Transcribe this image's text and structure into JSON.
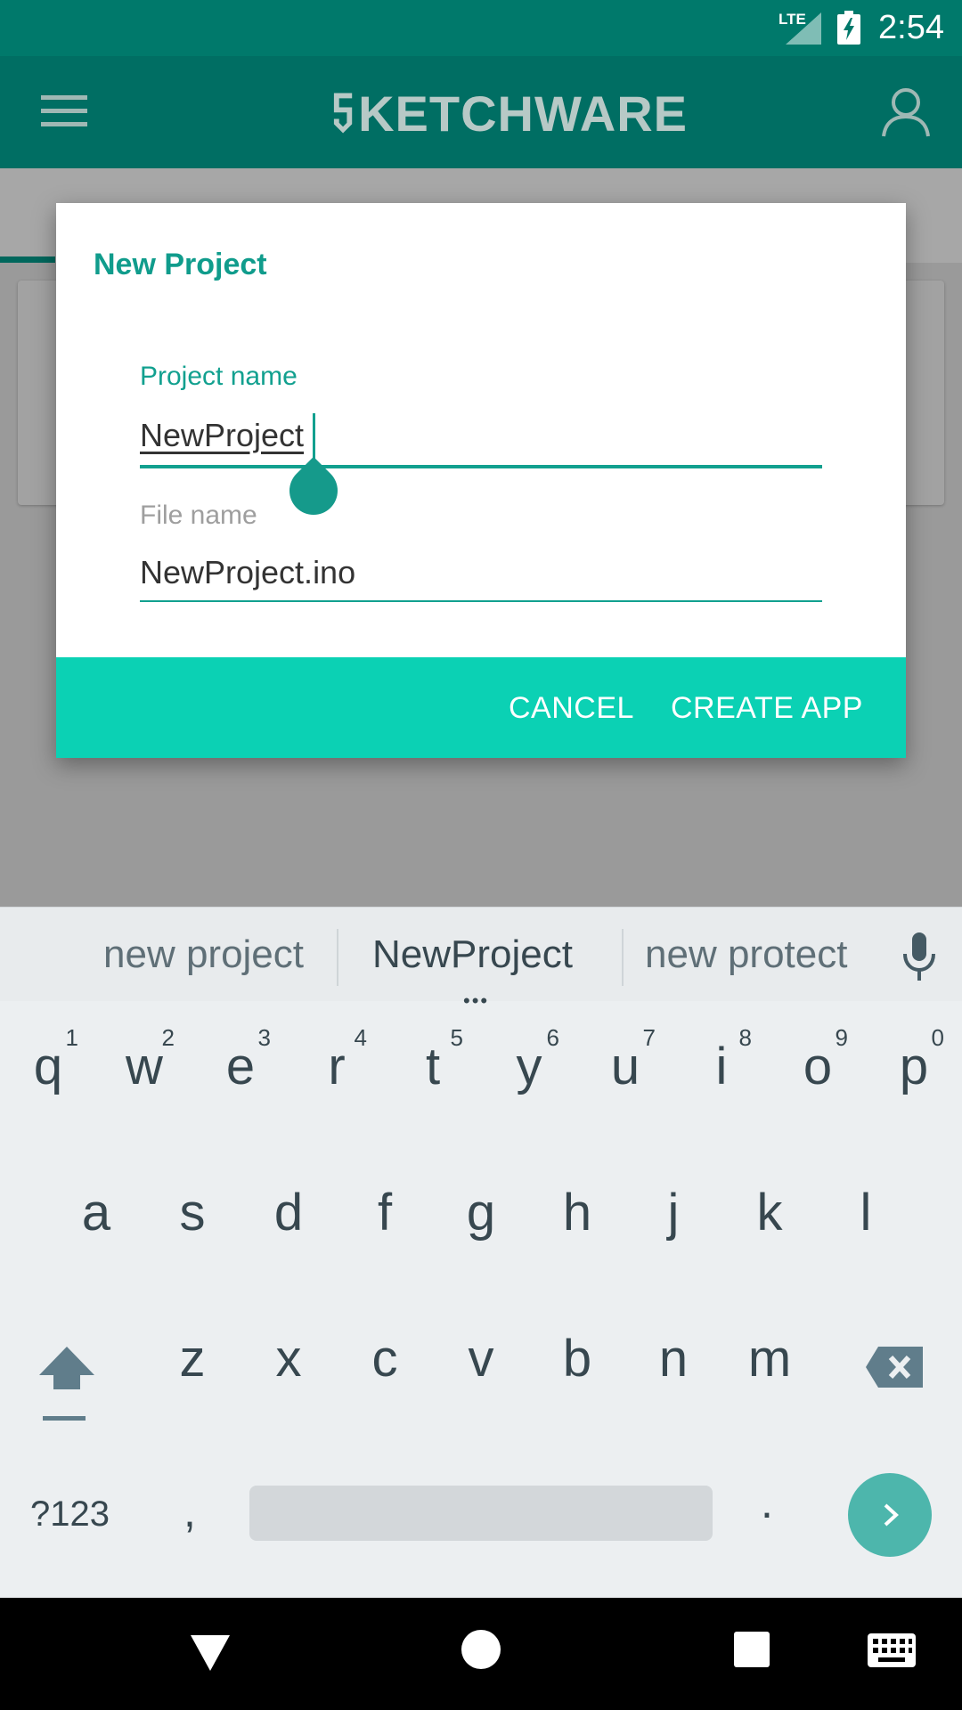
{
  "status_bar": {
    "network": "LTE",
    "time": "2:54"
  },
  "app_bar": {
    "logo_text": "KETCHWARE"
  },
  "dialog": {
    "title": "New Project",
    "project_name": {
      "label": "Project name",
      "value": "NewProject"
    },
    "file_name": {
      "label": "File name",
      "value": "NewProject.ino"
    },
    "cancel_label": "CANCEL",
    "create_label": "CREATE APP"
  },
  "keyboard": {
    "suggestions": [
      "new project",
      "NewProject",
      "new protect"
    ],
    "suggestion_dots": "•••",
    "row1": [
      {
        "k": "q",
        "h": "1"
      },
      {
        "k": "w",
        "h": "2"
      },
      {
        "k": "e",
        "h": "3"
      },
      {
        "k": "r",
        "h": "4"
      },
      {
        "k": "t",
        "h": "5"
      },
      {
        "k": "y",
        "h": "6"
      },
      {
        "k": "u",
        "h": "7"
      },
      {
        "k": "i",
        "h": "8"
      },
      {
        "k": "o",
        "h": "9"
      },
      {
        "k": "p",
        "h": "0"
      }
    ],
    "row2": [
      "a",
      "s",
      "d",
      "f",
      "g",
      "h",
      "j",
      "k",
      "l"
    ],
    "row3": [
      "z",
      "x",
      "c",
      "v",
      "b",
      "n",
      "m"
    ],
    "symbols_label": "?123",
    "comma": ",",
    "period": "."
  },
  "colors": {
    "status_bar": "#00796b",
    "app_bar": "#006e63",
    "accent": "#12a08f",
    "dialog_actions": "#0bd1b4",
    "enter_key": "#4db6ac"
  }
}
